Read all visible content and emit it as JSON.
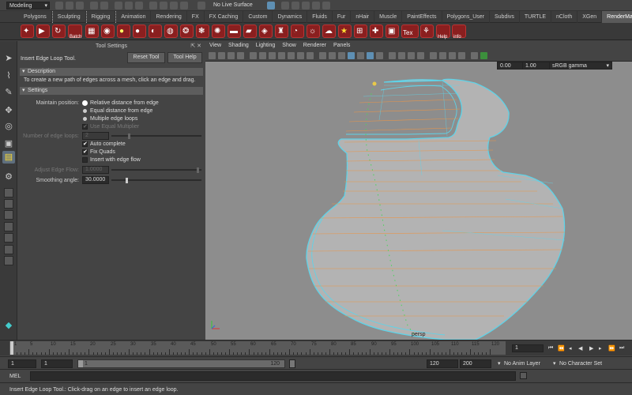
{
  "status_line": {
    "mode": "Modeling",
    "live_surface": "No Live Surface"
  },
  "shelf_tabs": [
    "Polygons",
    "Sculpting",
    "Rigging",
    "Animation",
    "Rendering",
    "FX",
    "FX Caching",
    "Custom",
    "Dynamics",
    "Fluids",
    "Fur",
    "nHair",
    "Muscle",
    "PaintEffects",
    "Polygons_User",
    "Subdivs",
    "TURTLE",
    "nCloth",
    "XGen",
    "RenderMan"
  ],
  "active_shelf_tab": "RenderMan",
  "shelf_labels": {
    "batch": "Batch",
    "tex": "Tex",
    "help": "Help",
    "info": "info"
  },
  "tool_settings": {
    "panel_title": "Tool Settings",
    "tool_name": "Insert Edge Loop Tool.",
    "reset_button": "Reset Tool",
    "help_button": "Tool Help",
    "description_header": "Description",
    "description_text": "To create a new path of edges across a mesh, click an edge and drag.",
    "settings_header": "Settings",
    "maintain_position_label": "Maintain position:",
    "maintain_position_options": [
      "Relative distance from edge",
      "Equal distance from edge",
      "Multiple edge loops"
    ],
    "maintain_position_selected": "Relative distance from edge",
    "use_equal_multiplier": "Use Equal Multiplier",
    "number_of_edge_loops_label": "Number of edge loops:",
    "number_of_edge_loops_value": "2",
    "auto_complete": "Auto complete",
    "fix_quads": "Fix Quads",
    "insert_with_edge_flow": "Insert with edge flow",
    "adjust_edge_flow_label": "Adjust Edge Flow:",
    "adjust_edge_flow_value": "1.0000",
    "smoothing_angle_label": "Smoothing angle:",
    "smoothing_angle_value": "30.0000"
  },
  "checkbox_states": {
    "use_equal_multiplier": true,
    "auto_complete": true,
    "fix_quads": true,
    "insert_with_edge_flow": false
  },
  "viewport": {
    "menus": [
      "View",
      "Shading",
      "Lighting",
      "Show",
      "Renderer",
      "Panels"
    ],
    "exposure": "0.00",
    "gamma": "1.00",
    "color_space": "sRGB gamma",
    "camera_label": "persp",
    "mesh_wire_color": "#5fd3e8",
    "edge_loop_color": "#e8954a",
    "bg_color": "#8d8d8d"
  },
  "timeline": {
    "ticks": [
      "1",
      "5",
      "10",
      "15",
      "20",
      "25",
      "30",
      "35",
      "40",
      "45",
      "50",
      "55",
      "60",
      "65",
      "70",
      "75",
      "80",
      "85",
      "90",
      "95",
      "100",
      "105",
      "110",
      "115",
      "120"
    ],
    "current_frame": "1"
  },
  "range": {
    "start": "1",
    "playback_start": "1",
    "bar_left": "1",
    "bar_right": "120",
    "playback_end": "120",
    "end": "200",
    "anim_layer": "No Anim Layer",
    "character_set": "No Character Set"
  },
  "command_line": {
    "label": "MEL"
  },
  "help_line": {
    "text": "Insert Edge Loop Tool.: Click-drag on an edge to insert an edge loop."
  }
}
